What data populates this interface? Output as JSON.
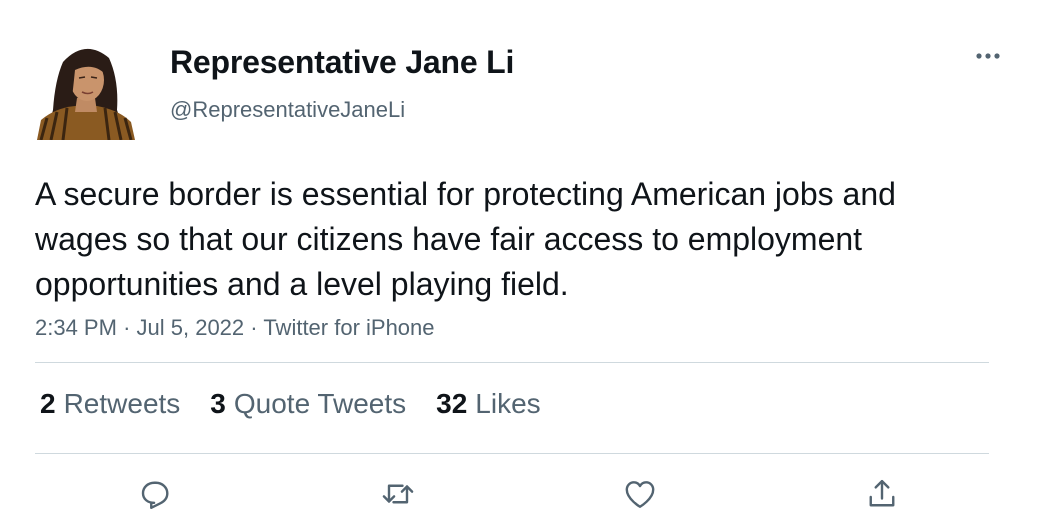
{
  "author": {
    "name": "Representative Jane Li",
    "handle": "@RepresentativeJaneLi"
  },
  "tweet": {
    "text": "A secure border is essential for protecting American jobs and wages so that our citizens have fair access to employment opportunities and a level playing field.",
    "time": "2:34 PM",
    "date": "Jul 5, 2022",
    "source": "Twitter for iPhone",
    "separator": "·"
  },
  "stats": {
    "retweets_count": "2",
    "retweets_label": "Retweets",
    "quotes_count": "3",
    "quotes_label": "Quote Tweets",
    "likes_count": "32",
    "likes_label": "Likes"
  },
  "icons": {
    "more": "more-icon",
    "reply": "reply-icon",
    "retweet": "retweet-icon",
    "like": "like-icon",
    "share": "share-icon"
  },
  "colors": {
    "text": "#0f1419",
    "secondary": "#536471",
    "divider": "#cfd9de"
  }
}
